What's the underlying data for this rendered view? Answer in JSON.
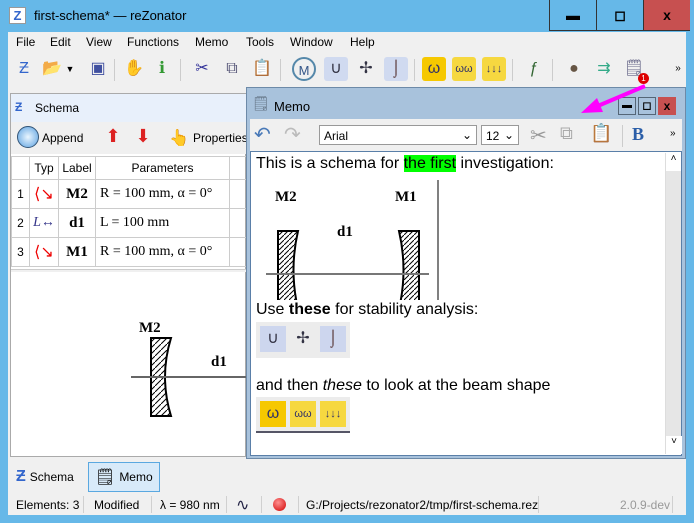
{
  "window": {
    "title": "first-schema* — reZonator",
    "minimize": "▬",
    "maximize": "◻",
    "close": "x"
  },
  "menu": [
    "File",
    "Edit",
    "View",
    "Functions",
    "Memo",
    "Tools",
    "Window",
    "Help"
  ],
  "toolbar": {
    "icons": [
      "new-schema-icon",
      "open-icon",
      "save-icon",
      "edit-elements-icon",
      "schema-info-icon",
      "cut-icon",
      "copy-icon",
      "paste-icon",
      "matrix-icon",
      "stability-map-icon",
      "stability-map-2d-icon",
      "stability-trend-icon",
      "beam-size-icon",
      "multi-beam-icon",
      "multi-caustic-icon",
      "frequency-icon",
      "adjust-icon",
      "transfer-icon",
      "memo-icon"
    ],
    "overflow": "»",
    "memo_badge": "1"
  },
  "schema": {
    "title": "Schema",
    "append": "Append",
    "properties": "Properties",
    "columns": [
      "Typ",
      "Label",
      "Parameters"
    ],
    "rows": [
      {
        "n": "1",
        "type": "curved-mirror",
        "label": "M2",
        "params": "R = 100 mm, α = 0°"
      },
      {
        "n": "2",
        "type": "distance",
        "label": "d1",
        "params": "L = 100 mm"
      },
      {
        "n": "3",
        "type": "curved-mirror",
        "label": "M1",
        "params": "R = 100 mm, α = 0°"
      }
    ],
    "canvas": {
      "mirror": "M2",
      "distance": "d1"
    }
  },
  "memo": {
    "title": "Memo",
    "font": "Arial",
    "size": "12",
    "bold": "B",
    "overflow": "»",
    "line1": {
      "before": "This is a schema for ",
      "highlight": "the first",
      "after": " investigation:"
    },
    "diagram": {
      "left": "M2",
      "right": "M1",
      "distance": "d1"
    },
    "line2": {
      "before": "Use ",
      "bold": "these",
      "after": " for stability analysis:"
    },
    "line3": {
      "before": "and then ",
      "italic": "these",
      "after": " to look at the beam shape"
    },
    "highlight_color": "#00ff00"
  },
  "tabs": [
    {
      "label": "Schema"
    },
    {
      "label": "Memo",
      "active": true
    }
  ],
  "status": {
    "elements": "Elements: 3",
    "modified": "Modified",
    "lambda": "λ = 980 nm",
    "path": "G:/Projects/rezonator2/tmp/first-schema.rez",
    "version": "2.0.9-dev"
  },
  "annotation": {
    "arrow_color": "#ff00ff"
  }
}
